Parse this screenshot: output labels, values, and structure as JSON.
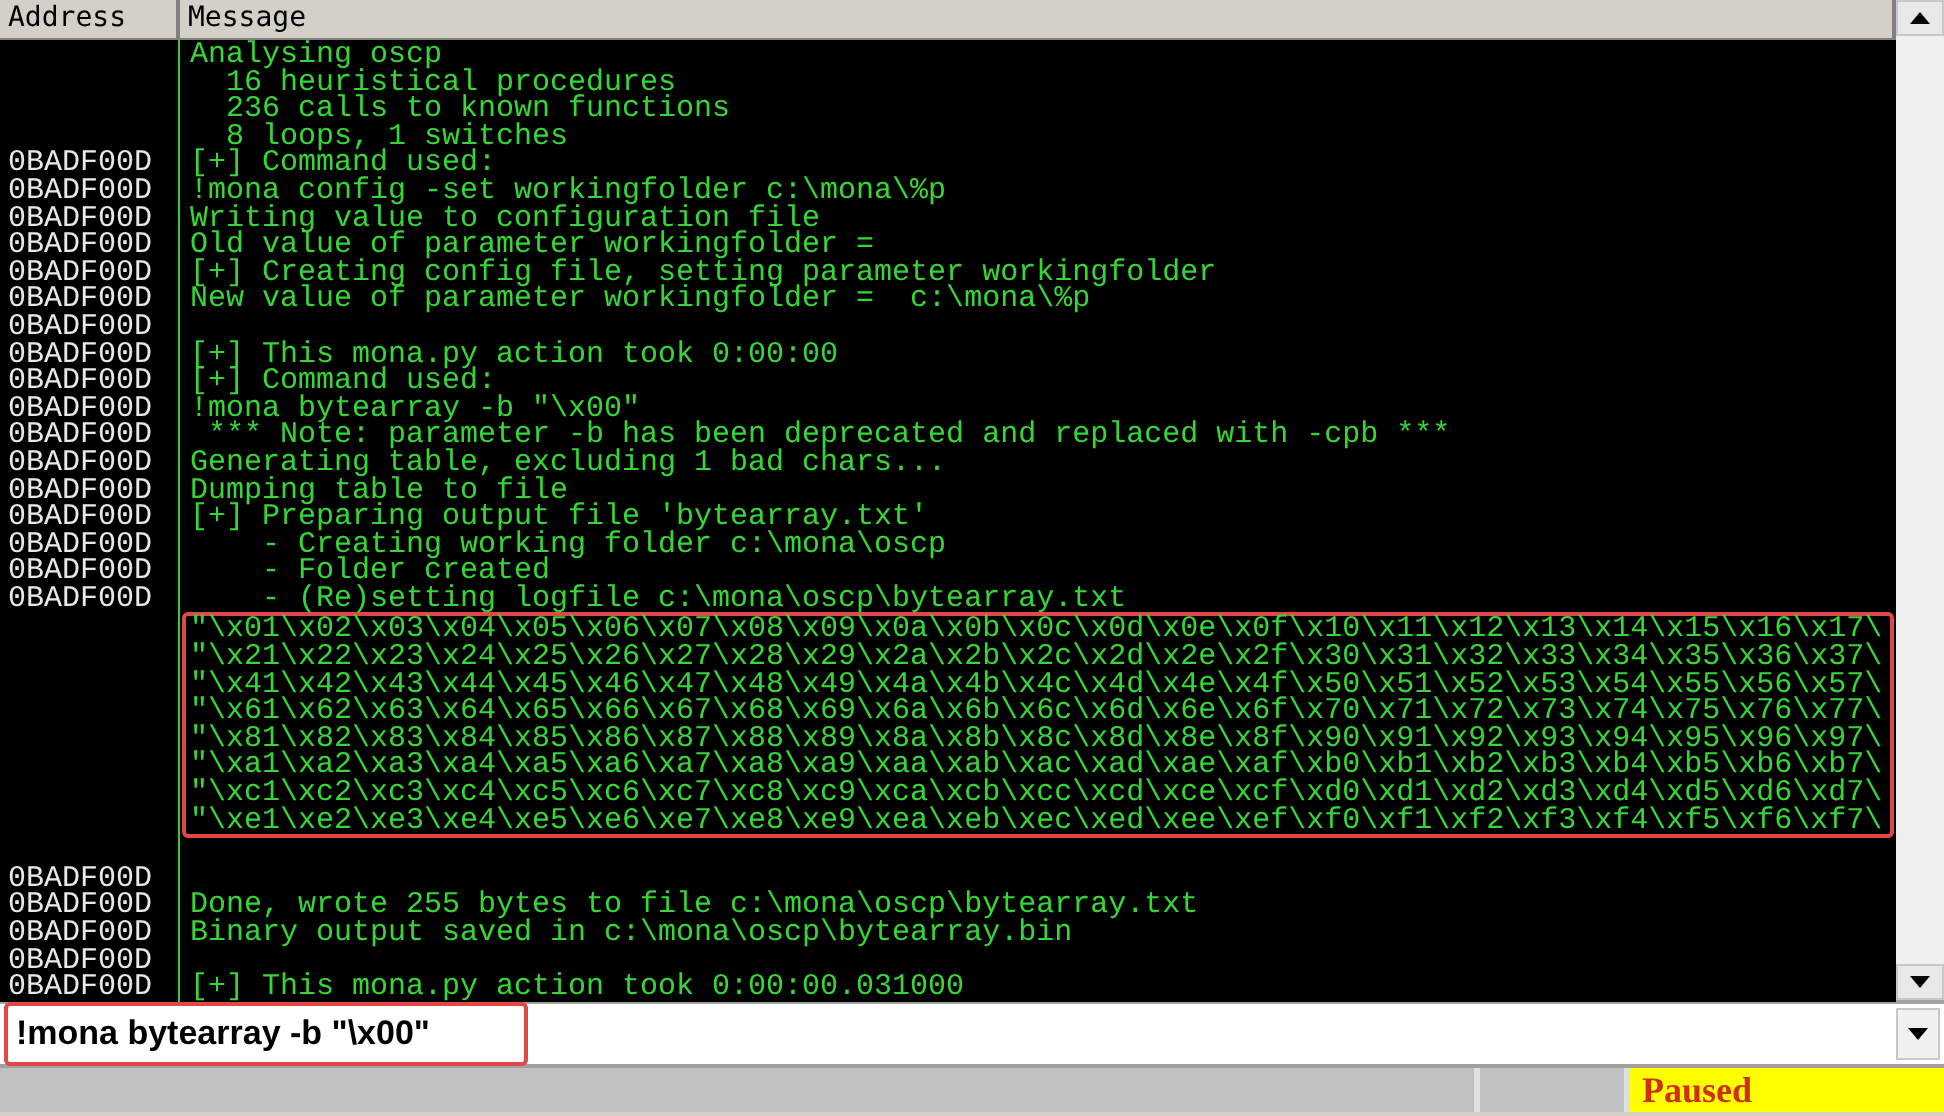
{
  "log": {
    "columns": [
      "Address",
      "Message"
    ],
    "entries": [
      {
        "kind": "line",
        "message": "Analysing oscp"
      },
      {
        "kind": "line",
        "message": "  16 heuristical procedures"
      },
      {
        "kind": "line",
        "message": "  236 calls to known functions"
      },
      {
        "kind": "line",
        "message": "  8 loops, 1 switches"
      },
      {
        "kind": "line",
        "address": "0BADF00D",
        "message": "[+] Command used:"
      },
      {
        "kind": "line",
        "address": "0BADF00D",
        "message": "!mona config -set workingfolder c:\\mona\\%p"
      },
      {
        "kind": "line",
        "address": "0BADF00D",
        "message": "Writing value to configuration file"
      },
      {
        "kind": "line",
        "address": "0BADF00D",
        "message": "Old value of parameter workingfolder ="
      },
      {
        "kind": "line",
        "address": "0BADF00D",
        "message": "[+] Creating config file, setting parameter workingfolder"
      },
      {
        "kind": "line",
        "address": "0BADF00D",
        "message": "New value of parameter workingfolder =  c:\\mona\\%p"
      },
      {
        "kind": "line",
        "address": "0BADF00D"
      },
      {
        "kind": "line",
        "address": "0BADF00D",
        "message": "[+] This mona.py action took 0:00:00"
      },
      {
        "kind": "line",
        "address": "0BADF00D",
        "message": "[+] Command used:"
      },
      {
        "kind": "line",
        "address": "0BADF00D",
        "message": "!mona bytearray -b \"\\x00\""
      },
      {
        "kind": "line",
        "address": "0BADF00D",
        "message": " *** Note: parameter -b has been deprecated and replaced with -cpb ***"
      },
      {
        "kind": "line",
        "address": "0BADF00D",
        "message": "Generating table, excluding 1 bad chars..."
      },
      {
        "kind": "line",
        "address": "0BADF00D",
        "message": "Dumping table to file"
      },
      {
        "kind": "line",
        "address": "0BADF00D",
        "message": "[+] Preparing output file 'bytearray.txt'"
      },
      {
        "kind": "line",
        "address": "0BADF00D",
        "message": "    - Creating working folder c:\\mona\\oscp"
      },
      {
        "kind": "line",
        "address": "0BADF00D",
        "message": "    - Folder created"
      },
      {
        "kind": "line",
        "address": "0BADF00D",
        "message": "    - (Re)setting logfile c:\\mona\\oscp\\bytearray.txt"
      },
      {
        "kind": "highlight",
        "lines": [
          "\"\\x01\\x02\\x03\\x04\\x05\\x06\\x07\\x08\\x09\\x0a\\x0b\\x0c\\x0d\\x0e\\x0f\\x10\\x11\\x12\\x13\\x14\\x15\\x16\\x17\\",
          "\"\\x21\\x22\\x23\\x24\\x25\\x26\\x27\\x28\\x29\\x2a\\x2b\\x2c\\x2d\\x2e\\x2f\\x30\\x31\\x32\\x33\\x34\\x35\\x36\\x37\\",
          "\"\\x41\\x42\\x43\\x44\\x45\\x46\\x47\\x48\\x49\\x4a\\x4b\\x4c\\x4d\\x4e\\x4f\\x50\\x51\\x52\\x53\\x54\\x55\\x56\\x57\\",
          "\"\\x61\\x62\\x63\\x64\\x65\\x66\\x67\\x68\\x69\\x6a\\x6b\\x6c\\x6d\\x6e\\x6f\\x70\\x71\\x72\\x73\\x74\\x75\\x76\\x77\\",
          "\"\\x81\\x82\\x83\\x84\\x85\\x86\\x87\\x88\\x89\\x8a\\x8b\\x8c\\x8d\\x8e\\x8f\\x90\\x91\\x92\\x93\\x94\\x95\\x96\\x97\\",
          "\"\\xa1\\xa2\\xa3\\xa4\\xa5\\xa6\\xa7\\xa8\\xa9\\xaa\\xab\\xac\\xad\\xae\\xaf\\xb0\\xb1\\xb2\\xb3\\xb4\\xb5\\xb6\\xb7\\",
          "\"\\xc1\\xc2\\xc3\\xc4\\xc5\\xc6\\xc7\\xc8\\xc9\\xca\\xcb\\xcc\\xcd\\xce\\xcf\\xd0\\xd1\\xd2\\xd3\\xd4\\xd5\\xd6\\xd7\\",
          "\"\\xe1\\xe2\\xe3\\xe4\\xe5\\xe6\\xe7\\xe8\\xe9\\xea\\xeb\\xec\\xed\\xee\\xef\\xf0\\xf1\\xf2\\xf3\\xf4\\xf5\\xf6\\xf7\\"
        ]
      },
      {
        "kind": "line"
      },
      {
        "kind": "line",
        "address": "0BADF00D"
      },
      {
        "kind": "line",
        "address": "0BADF00D",
        "message": "Done, wrote 255 bytes to file c:\\mona\\oscp\\bytearray.txt"
      },
      {
        "kind": "line",
        "address": "0BADF00D",
        "message": "Binary output saved in c:\\mona\\oscp\\bytearray.bin"
      },
      {
        "kind": "line",
        "address": "0BADF00D"
      },
      {
        "kind": "line",
        "address": "0BADF00D",
        "message": "[+] This mona.py action took 0:00:00.031000"
      }
    ]
  },
  "command": {
    "value": "!mona bytearray -b \"\\x00\"",
    "highlighted": true
  },
  "status_bar": {
    "state": "Paused"
  }
}
